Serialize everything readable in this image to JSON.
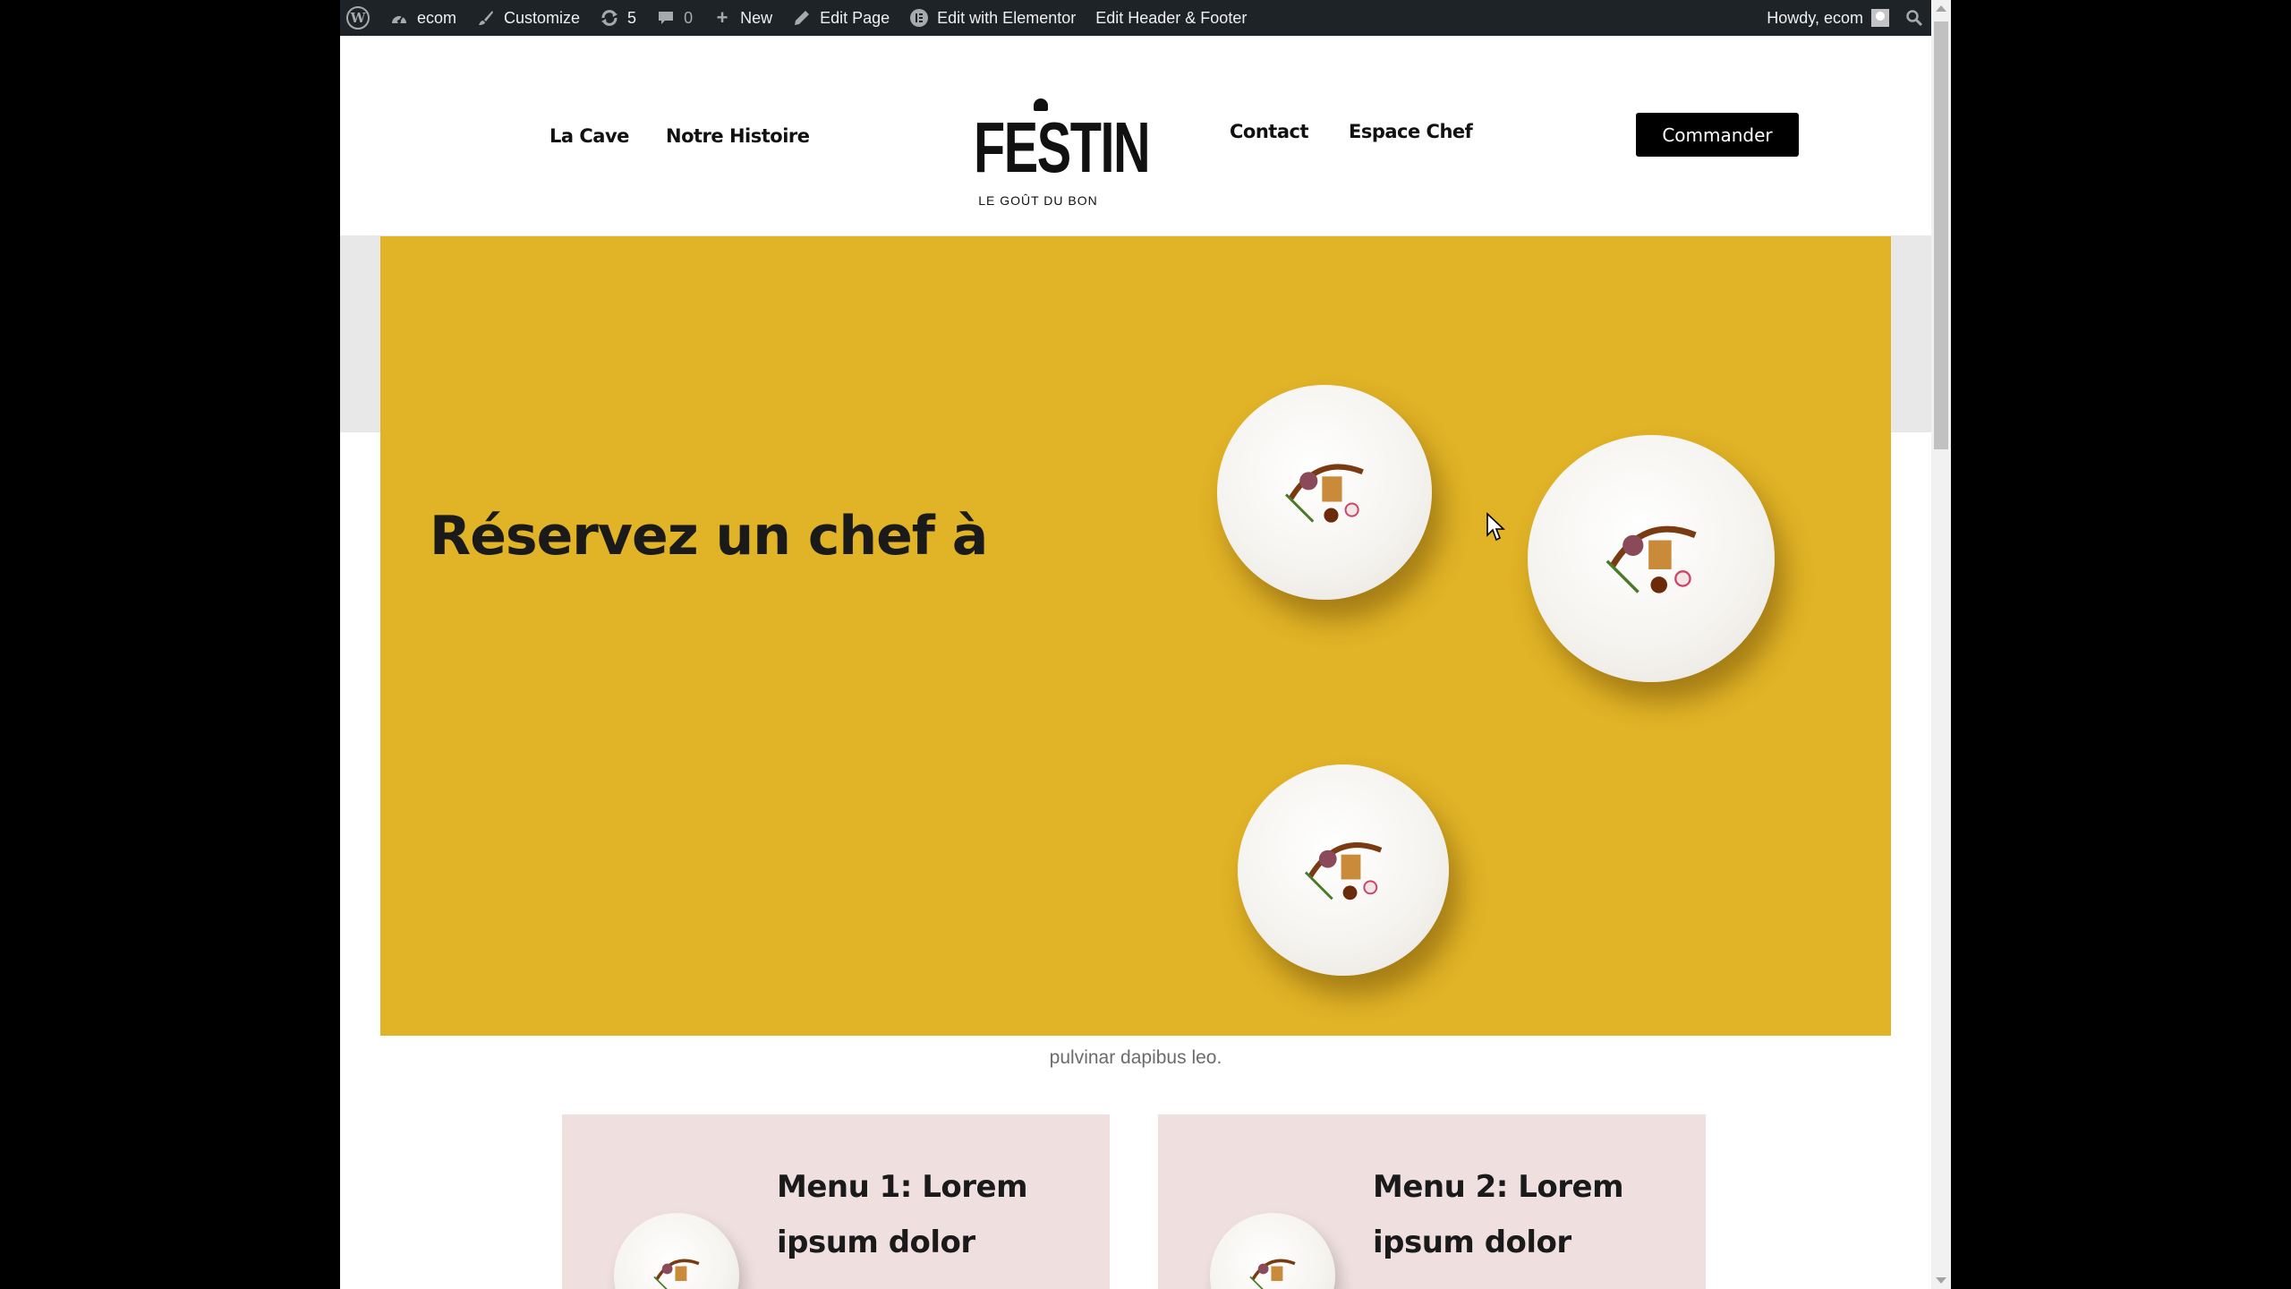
{
  "admin_bar": {
    "site_name": "ecom",
    "customize": "Customize",
    "updates": "5",
    "comments": "0",
    "new": "New",
    "edit_page": "Edit Page",
    "edit_elementor": "Edit with Elementor",
    "edit_header_footer": "Edit Header & Footer",
    "howdy": "Howdy, ecom",
    "icons": [
      "wordpress-logo",
      "dashboard-icon",
      "brush-icon",
      "refresh-icon",
      "comment-icon",
      "plus-icon",
      "pencil-icon",
      "elementor-icon",
      "search-icon"
    ]
  },
  "header": {
    "nav_left": [
      "La Cave",
      "Notre Histoire"
    ],
    "nav_right": [
      "Contact",
      "Espace Chef"
    ],
    "logo_text": "FESTIN",
    "logo_tagline": "LE GOÛT DU BON",
    "cta_label": "Commander"
  },
  "hero": {
    "title": "Réservez un chef à",
    "caption": "pulvinar dapibus leo.",
    "background_color": "#e1b326"
  },
  "menus": [
    {
      "title": "Menu 1: Lorem ipsum dolor"
    },
    {
      "title": "Menu 2: Lorem ipsum dolor"
    }
  ],
  "colors": {
    "admin_bar": "#1d2327",
    "card_bg": "#efdfdf",
    "cta_bg": "#000000"
  }
}
